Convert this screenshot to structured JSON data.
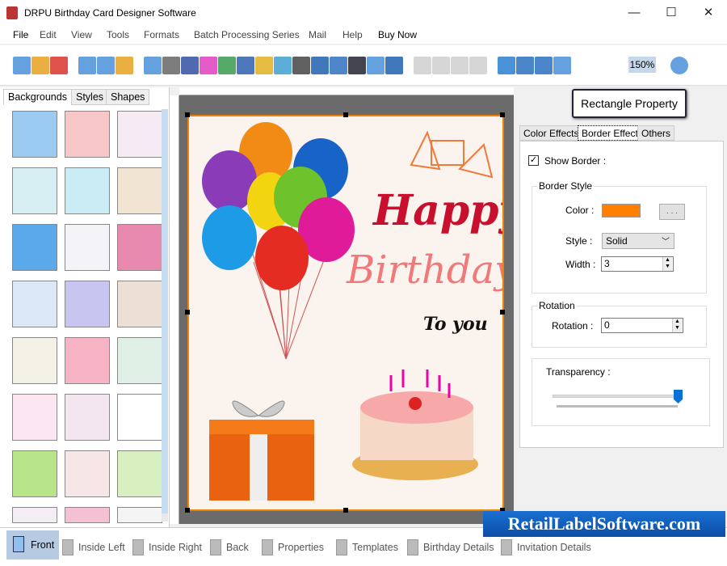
{
  "window": {
    "title": "DRPU Birthday Card Designer Software",
    "minimize": "—",
    "maximize": "☐",
    "close": "✕"
  },
  "menu": [
    "File",
    "Edit",
    "View",
    "Tools",
    "Formats",
    "Batch Processing Series",
    "Mail",
    "Help",
    "Buy Now"
  ],
  "toolbar": {
    "zoom_value": "150%"
  },
  "left_panel": {
    "tabs": [
      "Backgrounds",
      "Styles",
      "Shapes"
    ],
    "active_tab": "Backgrounds"
  },
  "card": {
    "line1": "Happy",
    "line2": "Birthday",
    "line3": "To you"
  },
  "right_panel": {
    "title_button": "Rectangle Property",
    "tabs": [
      "Color Effects",
      "Border Effect",
      "Others"
    ],
    "active_tab": "Border Effect",
    "show_border_label": "Show Border :",
    "show_border": true,
    "border_style_group": "Border Style",
    "color_label": "Color :",
    "color_value": "#ff8000",
    "color_picker_button": ". . .",
    "style_label": "Style :",
    "style_value": "Solid",
    "width_label": "Width :",
    "width_value": "3",
    "rotation_group": "Rotation",
    "rotation_label": "Rotation :",
    "rotation_value": "0",
    "transparency_label": "Transparency :",
    "transparency_level": 1.0
  },
  "bottom_bar": [
    "Front",
    "Inside Left",
    "Inside Right",
    "Back",
    "Properties",
    "Templates",
    "Birthday Details",
    "Invitation Details"
  ],
  "watermark": "RetailLabelSoftware.com"
}
